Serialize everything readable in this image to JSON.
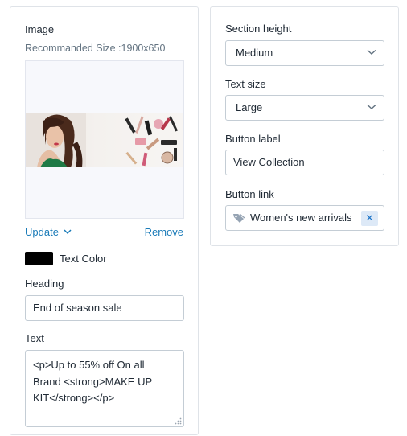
{
  "image_section": {
    "title": "Image",
    "recommended_size": "Recommanded Size :1900x650",
    "update_label": "Update",
    "remove_label": "Remove"
  },
  "text_color": {
    "label": "Text Color",
    "value": "#000000"
  },
  "heading": {
    "label": "Heading",
    "value": "End of season sale"
  },
  "text": {
    "label": "Text",
    "lines": [
      "<p>Up to 55% off On all",
      "Brand <strong>MAKE UP",
      "KIT</strong></p>"
    ]
  },
  "section_height": {
    "label": "Section height",
    "value": "Medium"
  },
  "text_size": {
    "label": "Text size",
    "value": "Large"
  },
  "button_label": {
    "label": "Button label",
    "value": "View Collection"
  },
  "button_link": {
    "label": "Button link",
    "value": "Women's new arrivals",
    "remove_glyph": "✕"
  },
  "colors": {
    "accent": "#1a7bb8",
    "border": "#c4cdd5"
  }
}
